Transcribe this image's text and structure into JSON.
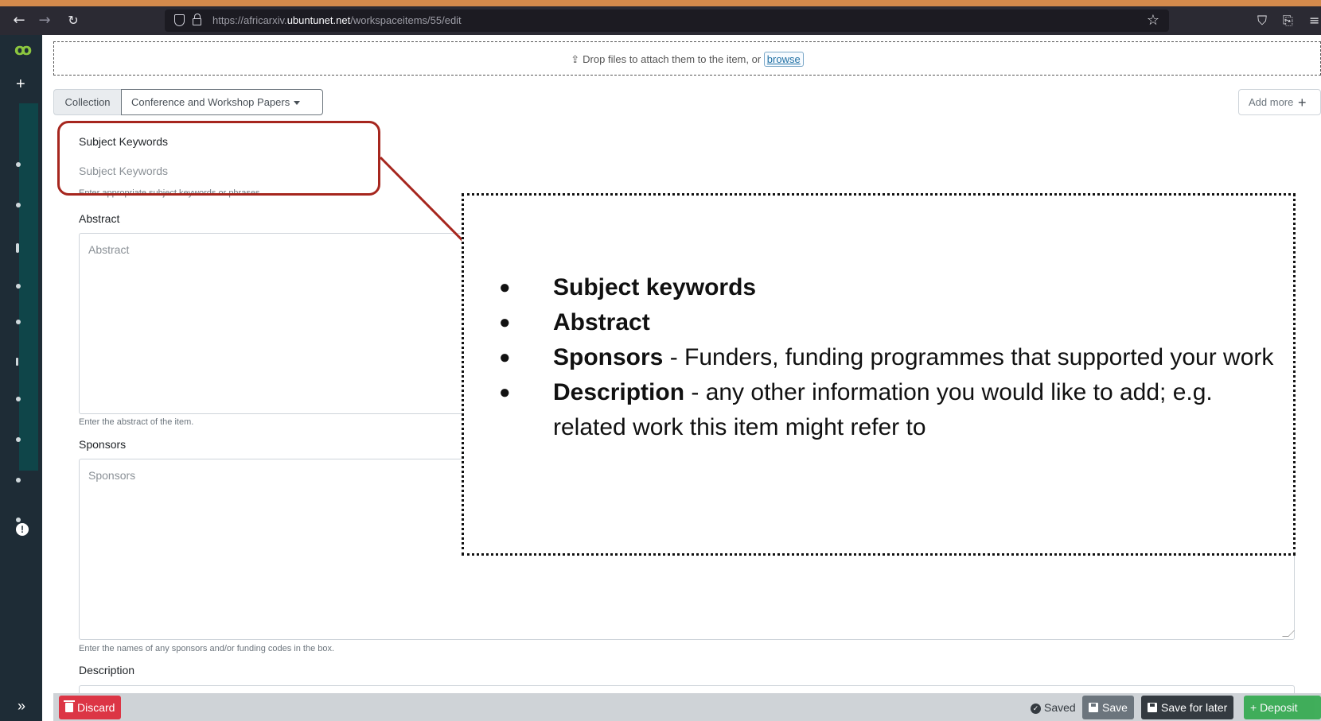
{
  "browser": {
    "url_prefix": "https://africarxiv.",
    "url_domain": "ubuntunet.net",
    "url_path": "/workspaceitems/55/edit",
    "icons": [
      "back-arrow-icon",
      "forward-arrow-icon",
      "reload-icon",
      "shield-icon",
      "lock-icon",
      "bookmark-star-icon",
      "pocket-icon",
      "share-icon",
      "menu-icon"
    ]
  },
  "sidebar": {
    "plus_label": "+",
    "info_label": "!",
    "expand_label": "»"
  },
  "dropzone": {
    "text": "Drop files to attach them to the item, or",
    "browse": "browse"
  },
  "collection": {
    "label": "Collection",
    "value": "Conference and Workshop Papers"
  },
  "add_more": {
    "label": "Add more",
    "plus": "+"
  },
  "fields": {
    "subject": {
      "label": "Subject Keywords",
      "placeholder": "Subject Keywords",
      "hint": "Enter appropriate subject keywords or phrases."
    },
    "abstract": {
      "label": "Abstract",
      "placeholder": "Abstract",
      "hint": "Enter the abstract of the item."
    },
    "sponsors": {
      "label": "Sponsors",
      "placeholder": "Sponsors",
      "hint": "Enter the names of any sponsors and/or funding codes in the box."
    },
    "description": {
      "label": "Description"
    }
  },
  "footer": {
    "discard": "Discard",
    "saved": "Saved",
    "save": "Save",
    "save_later": "Save for later",
    "deposit": "+ Deposit"
  },
  "annotation": {
    "items": [
      {
        "bold": "Subject keywords",
        "rest": ""
      },
      {
        "bold": "Abstract",
        "rest": ""
      },
      {
        "bold": "Sponsors",
        "rest": " - Funders, funding programmes that supported your work"
      },
      {
        "bold": "Description",
        "rest": " - any other information you would like to add; e.g.  related work this item might refer to"
      }
    ],
    "colors": {
      "callout": "#a6261e"
    }
  }
}
